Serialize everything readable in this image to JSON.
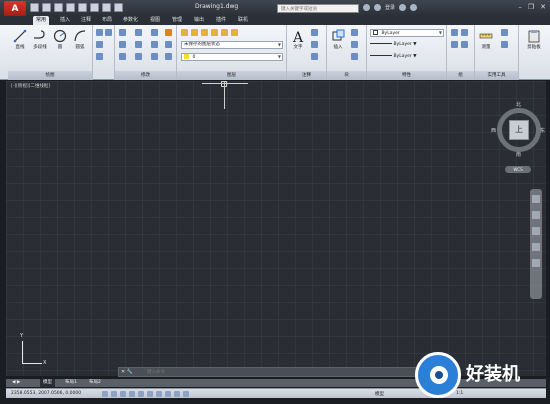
{
  "app": {
    "logo": "A",
    "document_title": "Drawing1.dwg"
  },
  "search": {
    "placeholder": "键入关键字或短语"
  },
  "account": {
    "login_label": "登录"
  },
  "window_controls": {
    "minimize": "–",
    "restore": "❐",
    "close": "✕"
  },
  "tabs": [
    "常用",
    "插入",
    "注释",
    "布局",
    "参数化",
    "视图",
    "管理",
    "输出",
    "插件",
    "联机"
  ],
  "panels": {
    "draw": {
      "title": "绘图",
      "tools": [
        "直线",
        "多段线",
        "圆",
        "圆弧"
      ]
    },
    "modify": {
      "title": "修改"
    },
    "layers": {
      "title": "图层",
      "layer_state": "未保存的图层状态",
      "current_layer": "0"
    },
    "annotation": {
      "title": "注释",
      "tools": [
        "文字"
      ]
    },
    "block": {
      "title": "块",
      "tools": [
        "插入"
      ]
    },
    "properties": {
      "title": "特性",
      "color": "ByLayer",
      "lineweight": "ByLayer",
      "linetype": "ByLayer"
    },
    "groups": {
      "title": "组"
    },
    "utilities": {
      "title": "实用工具",
      "tools": [
        "测量"
      ]
    },
    "clipboard": {
      "title": "",
      "tools": [
        "剪贴板"
      ]
    }
  },
  "viewport": {
    "label": "[-][俯视][二维线框]",
    "viewcube": {
      "north": "北",
      "south": "南",
      "east": "东",
      "west": "西",
      "face": "上",
      "wcs": "WCS"
    },
    "ucs": {
      "x": "X",
      "y": "Y"
    }
  },
  "command": {
    "close": "✕ 🔧",
    "placeholder": "键入命令"
  },
  "layout_tabs": [
    "模型",
    "布局1",
    "布局2"
  ],
  "status": {
    "coords": "2358.0553, 2007.0506, 0.0000",
    "model": "模型",
    "scale": "1:1"
  },
  "watermark": {
    "text": "好装机"
  },
  "colors": {
    "accent": "#2c7fd6",
    "app_red": "#c62a20",
    "drawing_bg": "#2a2d33"
  }
}
